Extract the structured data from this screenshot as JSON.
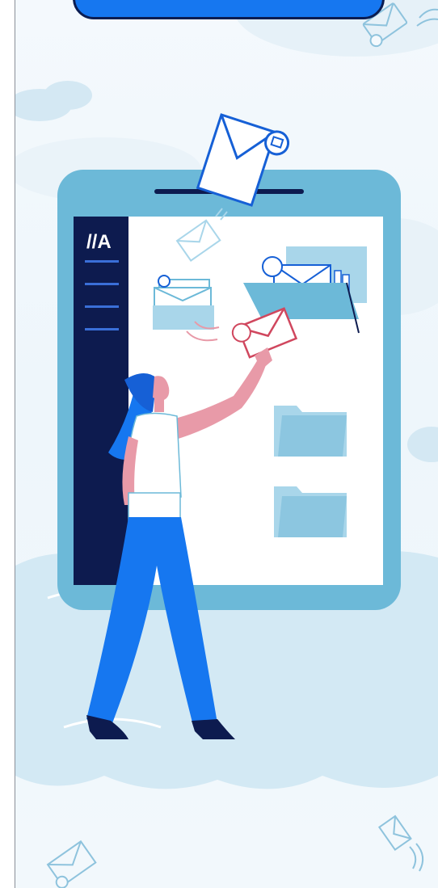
{
  "sidebar": {
    "logo_text": "//A",
    "menu_items_count": 4
  },
  "colors": {
    "sidebar": "#0d1b4f",
    "tablet_frame": "#6cb9d8",
    "primary_blue": "#1677f0",
    "pink": "#e89aa8",
    "folder": "#a9d6ea",
    "cloud": "#d6ebf5"
  }
}
